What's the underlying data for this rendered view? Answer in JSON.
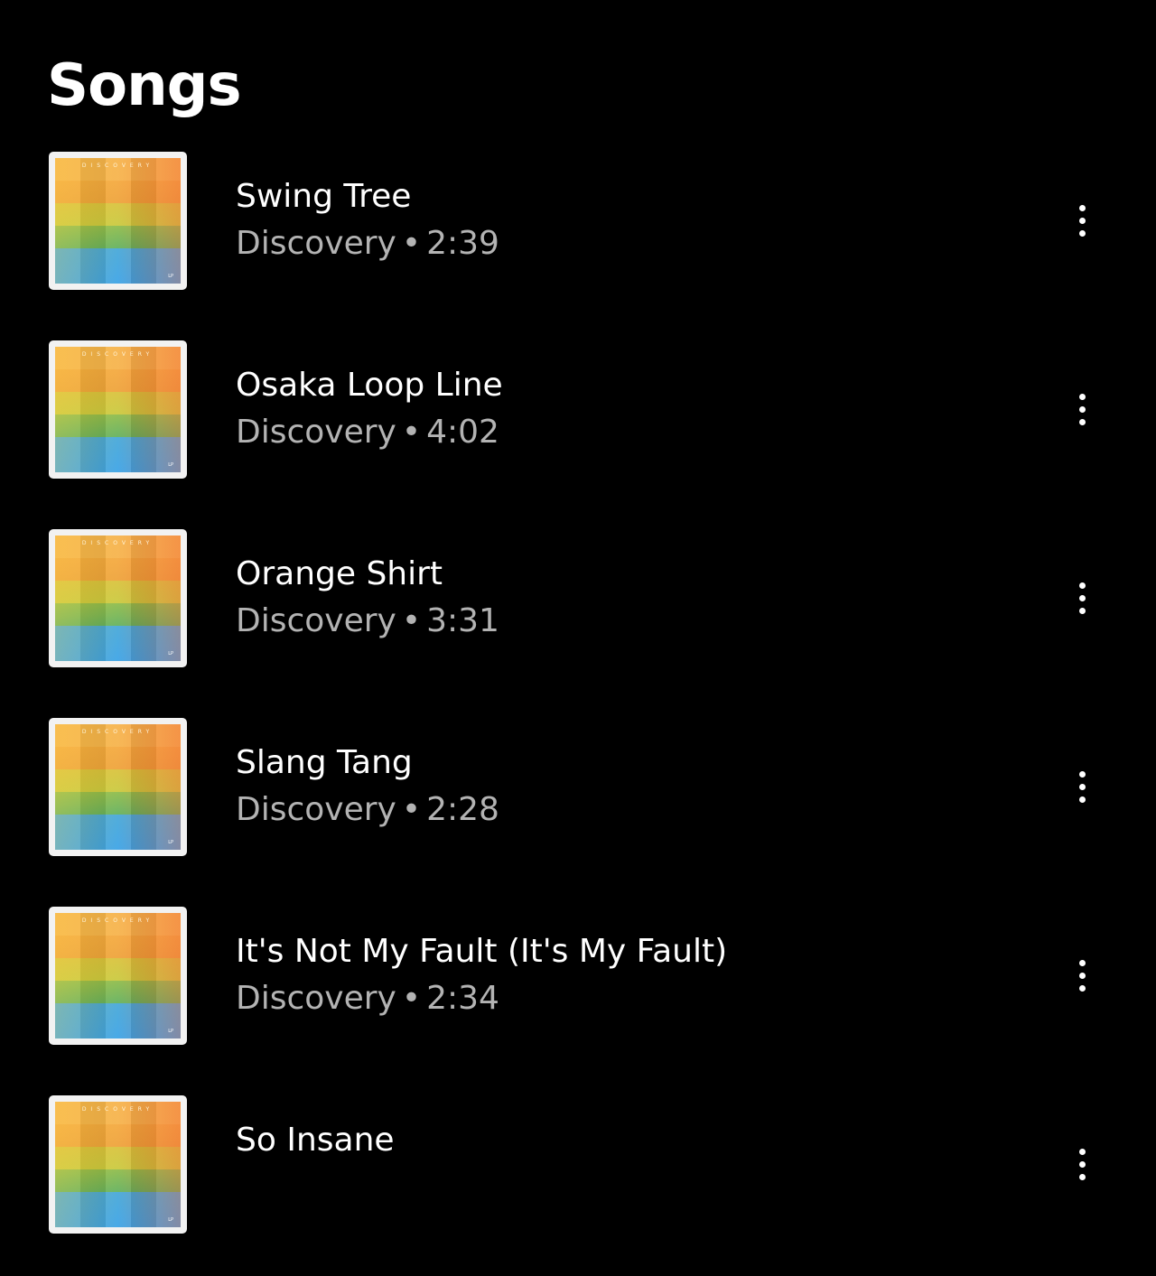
{
  "page": {
    "title": "Songs"
  },
  "cover": {
    "label": "DISCOVERY",
    "mark": "LP"
  },
  "songs": [
    {
      "title": "Swing Tree",
      "album": "Discovery",
      "separator": "•",
      "duration": "2:39"
    },
    {
      "title": "Osaka Loop Line",
      "album": "Discovery",
      "separator": "•",
      "duration": "4:02"
    },
    {
      "title": "Orange Shirt",
      "album": "Discovery",
      "separator": "•",
      "duration": "3:31"
    },
    {
      "title": "Slang Tang",
      "album": "Discovery",
      "separator": "•",
      "duration": "2:28"
    },
    {
      "title": "It's Not My Fault (It's My Fault)",
      "album": "Discovery",
      "separator": "•",
      "duration": "2:34"
    },
    {
      "title": "So Insane",
      "album": "",
      "separator": "",
      "duration": ""
    }
  ],
  "icons": {
    "more": "more-vertical-icon"
  },
  "colors": {
    "background": "#000000",
    "title": "#ffffff",
    "secondary_text": "#b3b3b3"
  }
}
